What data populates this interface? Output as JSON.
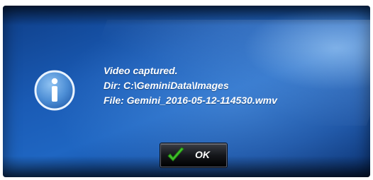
{
  "dialog": {
    "icon": "info-icon",
    "lines": [
      "Video captured.",
      "Dir: C:\\GeminiData\\Images",
      "File: Gemini_2016-05-12-114530.wmv"
    ],
    "ok_button": {
      "label": "OK",
      "icon": "checkmark-icon"
    }
  },
  "colors": {
    "background_blue": "#1a5bb5",
    "text": "#ffffff",
    "checkmark_green": "#3fbf2a"
  }
}
